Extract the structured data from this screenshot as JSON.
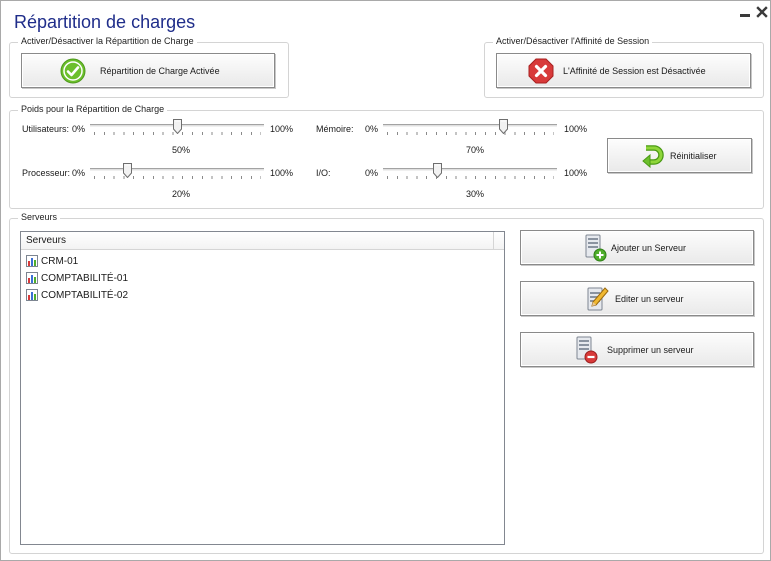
{
  "window": {
    "title": "Répartition de charges",
    "minimize_icon": "minimize-icon",
    "close_icon": "close-icon"
  },
  "load_balancing": {
    "group_label": "Activer/Désactiver la Répartition de Charge",
    "button_label": "Répartition de Charge Activée",
    "icon": "check-circle-icon",
    "enabled": true
  },
  "session_affinity": {
    "group_label": "Activer/Désactiver l'Affinité de Session",
    "button_label": "L'Affinité de Session est Désactivée",
    "icon": "error-octagon-icon",
    "enabled": false
  },
  "weights": {
    "group_label": "Poids pour la Répartition de Charge",
    "min_label": "0%",
    "max_label": "100%",
    "sliders": {
      "users": {
        "label": "Utilisateurs:",
        "value": 50,
        "value_label": "50%"
      },
      "processor": {
        "label": "Processeur:",
        "value": 20,
        "value_label": "20%"
      },
      "memory": {
        "label": "Mémoire:",
        "value": 70,
        "value_label": "70%"
      },
      "io": {
        "label": "I/O:",
        "value": 30,
        "value_label": "30%"
      }
    },
    "reset_label": "Réinitialiser",
    "reset_icon": "undo-arrow-icon"
  },
  "servers": {
    "group_label": "Serveurs",
    "column_header": "Serveurs",
    "items": [
      "CRM-01",
      "COMPTABILITÉ-01",
      "COMPTABILITÉ-02"
    ],
    "item_icon": "server-chart-icon",
    "add_label": "Ajouter un Serveur",
    "edit_label": "Editer un serveur",
    "delete_label": "Supprimer un serveur",
    "add_icon": "server-add-icon",
    "edit_icon": "server-edit-icon",
    "delete_icon": "server-remove-icon"
  },
  "colors": {
    "title": "#1f2d8a",
    "success_green": "#6cbf2c",
    "error_red": "#d83a3a"
  }
}
